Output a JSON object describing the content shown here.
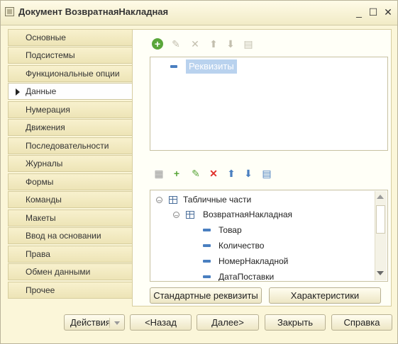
{
  "window": {
    "title": "Документ ВозвратнаяНакладная",
    "minimize": "_",
    "maximize": "☐",
    "close": "✕"
  },
  "tabs": [
    {
      "label": "Основные",
      "active": false
    },
    {
      "label": "Подсистемы",
      "active": false
    },
    {
      "label": "Функциональные опции",
      "active": false
    },
    {
      "label": "Данные",
      "active": true
    },
    {
      "label": "Нумерация",
      "active": false
    },
    {
      "label": "Движения",
      "active": false
    },
    {
      "label": "Последовательности",
      "active": false
    },
    {
      "label": "Журналы",
      "active": false
    },
    {
      "label": "Формы",
      "active": false
    },
    {
      "label": "Команды",
      "active": false
    },
    {
      "label": "Макеты",
      "active": false
    },
    {
      "label": "Ввод на основании",
      "active": false
    },
    {
      "label": "Права",
      "active": false
    },
    {
      "label": "Обмен данными",
      "active": false
    },
    {
      "label": "Прочее",
      "active": false
    }
  ],
  "attributes_panel": {
    "toolbar": [
      "add-icon",
      "edit-icon",
      "delete-icon",
      "move-up-icon",
      "move-down-icon",
      "sort-icon"
    ],
    "items": [
      "Реквизиты"
    ]
  },
  "tabular_panel": {
    "toolbar": [
      "add-table-icon",
      "add-column-icon",
      "edit-icon",
      "delete-icon",
      "move-up-icon",
      "move-down-icon",
      "sort-icon"
    ],
    "root": "Табличные части",
    "table": "ВозвратнаяНакладная",
    "columns": [
      "Товар",
      "Количество",
      "НомерНакладной",
      "ДатаПоставки"
    ]
  },
  "content_buttons": {
    "standard_attributes": "Стандартные реквизиты",
    "characteristics": "Характеристики"
  },
  "footer": {
    "actions": "Действия",
    "back": "<Назад",
    "next": "Далее>",
    "close": "Закрыть",
    "help": "Справка"
  },
  "colors": {
    "window_bg": "#fbf6d9",
    "selection": "#b9d2ee",
    "accent_blue": "#4a7fc0",
    "add_green": "#5aa63a",
    "delete_red": "#e0322d"
  }
}
